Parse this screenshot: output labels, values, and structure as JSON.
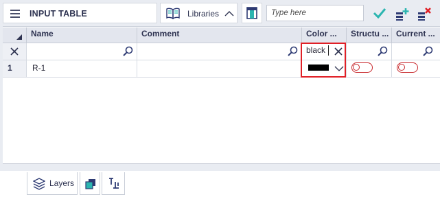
{
  "toolbar": {
    "title": "INPUT TABLE",
    "libraries_label": "Libraries",
    "search_placeholder": "Type here",
    "icons": [
      "menu-icon",
      "book-icon",
      "chevron-up-icon",
      "column-select-icon",
      "confirm-icon",
      "add-row-icon",
      "delete-row-icon"
    ]
  },
  "grid": {
    "columns": [
      "Name",
      "Comment",
      "Color ...",
      "Structu ...",
      "Current ..."
    ],
    "filter_row": {
      "clear_icon": "close-icon",
      "color_filter_value": "black"
    },
    "rows": [
      {
        "number": "1",
        "name": "R-1",
        "comment": "",
        "color": "#000000",
        "structural": false,
        "current": false
      }
    ]
  },
  "bottom_tabs": {
    "layers_label": "Layers",
    "icons": [
      "layers-icon",
      "cube-icon",
      "align-icon"
    ]
  },
  "colors": {
    "accent": "#2bb5b0",
    "highlight": "#e01f26",
    "toggle": "#c8282c"
  }
}
